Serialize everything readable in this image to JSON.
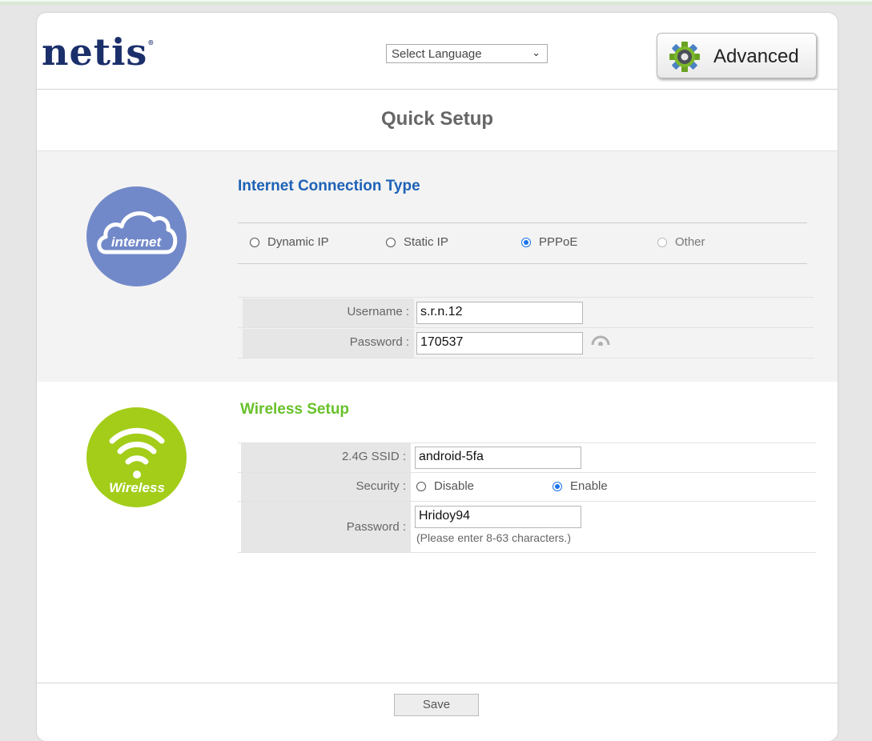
{
  "header": {
    "logo_text": "netis",
    "language_select": {
      "selected": "Select Language"
    },
    "advanced_label": "Advanced"
  },
  "page_title": "Quick Setup",
  "internet": {
    "icon_label": "internet",
    "heading": "Internet Connection Type",
    "connection_types": [
      {
        "label": "Dynamic IP",
        "checked": false
      },
      {
        "label": "Static IP",
        "checked": false
      },
      {
        "label": "PPPoE",
        "checked": true
      },
      {
        "label": "Other",
        "checked": false,
        "disabled": true
      }
    ],
    "username_label": "Username :",
    "username_value": "s.r.n.12",
    "password_label": "Password :",
    "password_value": "170537"
  },
  "wireless": {
    "icon_label": "Wireless",
    "heading": "Wireless Setup",
    "ssid_label": "2.4G SSID :",
    "ssid_value": "android-5fa",
    "security_label": "Security :",
    "security_options": [
      {
        "label": "Disable",
        "checked": false
      },
      {
        "label": "Enable",
        "checked": true
      }
    ],
    "password_label": "Password :",
    "password_value": "Hridoy94",
    "password_hint": "(Please enter 8-63 characters.)"
  },
  "footer": {
    "save_label": "Save"
  },
  "colors": {
    "logo": "#1b2f6b",
    "internet_heading": "#1d62b6",
    "wireless_heading": "#68c12a",
    "internet_circle": "#7289c9",
    "wireless_circle": "#a3cd19",
    "radio_checked": "#1a73e8"
  }
}
